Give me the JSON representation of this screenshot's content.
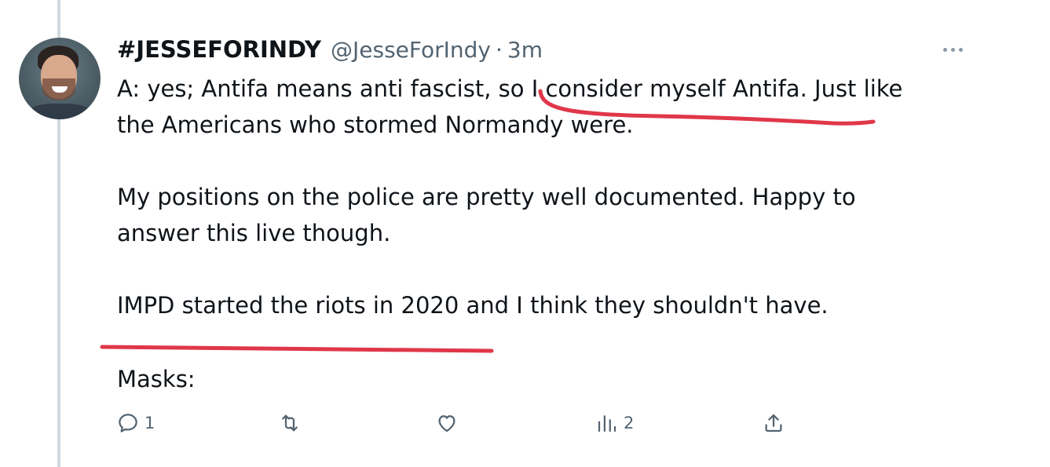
{
  "tweet": {
    "display_name": "#JESSEFORINDY",
    "handle": "@JesseForIndy",
    "separator": "·",
    "time": "3m",
    "lines": [
      "A: yes; Antifa means anti fascist, so I consider myself Antifa. Just like",
      "the Americans who stormed Normandy were.",
      "My positions on the police are pretty well documented. Happy to",
      "answer this live though.",
      "IMPD started the riots in 2020 and I think they shouldn't have.",
      "Masks:"
    ]
  },
  "actions": {
    "reply": {
      "icon": "reply-icon",
      "count": "1"
    },
    "retweet": {
      "icon": "retweet-icon",
      "count": ""
    },
    "like": {
      "icon": "heart-icon",
      "count": ""
    },
    "views": {
      "icon": "analytics-icon",
      "count": "2"
    },
    "share": {
      "icon": "share-icon",
      "count": ""
    }
  },
  "annotations": {
    "underline_color": "#e0374a"
  },
  "colors": {
    "text": "#0f1419",
    "secondary": "#536471",
    "thread_line": "#cfd9de"
  }
}
